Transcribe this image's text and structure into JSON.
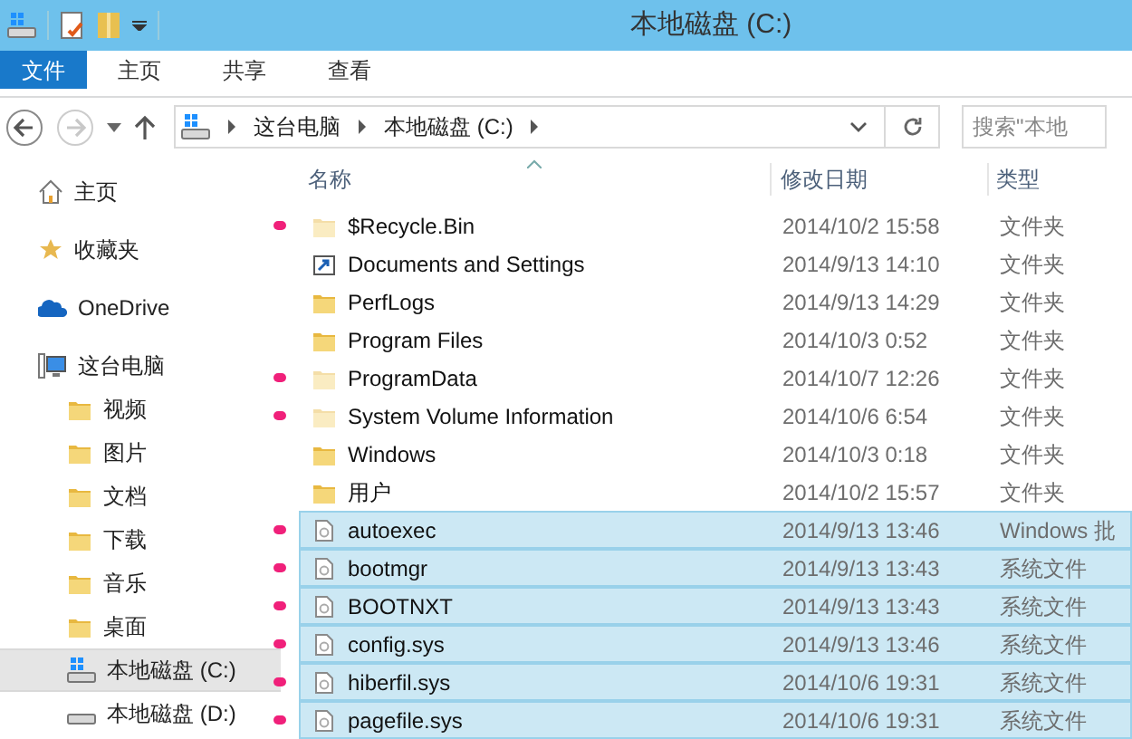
{
  "window": {
    "title": "本地磁盘 (C:)"
  },
  "ribbon_tabs": [
    {
      "label": "文件",
      "selected": true
    },
    {
      "label": "主页",
      "selected": false
    },
    {
      "label": "共享",
      "selected": false
    },
    {
      "label": "查看",
      "selected": false
    }
  ],
  "address": {
    "crumbs": [
      "这台电脑",
      "本地磁盘 (C:)"
    ]
  },
  "search": {
    "placeholder": "搜索\"本地"
  },
  "sidebar": {
    "items": [
      {
        "label": "主页",
        "kind": "home",
        "selected": false
      },
      {
        "label": "收藏夹",
        "kind": "star",
        "selected": false
      },
      {
        "label": "OneDrive",
        "kind": "cloud",
        "selected": false
      },
      {
        "label": "这台电脑",
        "kind": "computer",
        "selected": false,
        "children": [
          {
            "label": "视频",
            "kind": "folder",
            "selected": false
          },
          {
            "label": "图片",
            "kind": "folder",
            "selected": false
          },
          {
            "label": "文档",
            "kind": "folder",
            "selected": false
          },
          {
            "label": "下载",
            "kind": "folder",
            "selected": false
          },
          {
            "label": "音乐",
            "kind": "folder",
            "selected": false
          },
          {
            "label": "桌面",
            "kind": "folder",
            "selected": false
          },
          {
            "label": "本地磁盘 (C:)",
            "kind": "system-drive",
            "selected": true
          },
          {
            "label": "本地磁盘 (D:)",
            "kind": "drive",
            "selected": false
          }
        ]
      }
    ]
  },
  "table": {
    "columns": [
      "名称",
      "修改日期",
      "类型"
    ],
    "rows": [
      {
        "name": "$Recycle.Bin",
        "date": "2014/10/2 15:58",
        "type": "文件夹",
        "kind": "hidden-folder",
        "selected": false,
        "marked": true
      },
      {
        "name": "Documents and Settings",
        "date": "2014/9/13 14:10",
        "type": "文件夹",
        "kind": "shortcut",
        "selected": false,
        "marked": false
      },
      {
        "name": "PerfLogs",
        "date": "2014/9/13 14:29",
        "type": "文件夹",
        "kind": "folder",
        "selected": false,
        "marked": false
      },
      {
        "name": "Program Files",
        "date": "2014/10/3 0:52",
        "type": "文件夹",
        "kind": "folder",
        "selected": false,
        "marked": false
      },
      {
        "name": "ProgramData",
        "date": "2014/10/7 12:26",
        "type": "文件夹",
        "kind": "hidden-folder",
        "selected": false,
        "marked": true
      },
      {
        "name": "System Volume Information",
        "date": "2014/10/6 6:54",
        "type": "文件夹",
        "kind": "hidden-folder",
        "selected": false,
        "marked": true
      },
      {
        "name": "Windows",
        "date": "2014/10/3 0:18",
        "type": "文件夹",
        "kind": "folder",
        "selected": false,
        "marked": false
      },
      {
        "name": "用户",
        "date": "2014/10/2 15:57",
        "type": "文件夹",
        "kind": "folder",
        "selected": false,
        "marked": false
      },
      {
        "name": "autoexec",
        "date": "2014/9/13 13:46",
        "type": "Windows 批",
        "kind": "file",
        "selected": true,
        "marked": true
      },
      {
        "name": "bootmgr",
        "date": "2014/9/13 13:43",
        "type": "系统文件",
        "kind": "file",
        "selected": true,
        "marked": true
      },
      {
        "name": "BOOTNXT",
        "date": "2014/9/13 13:43",
        "type": "系统文件",
        "kind": "file",
        "selected": true,
        "marked": true
      },
      {
        "name": "config.sys",
        "date": "2014/9/13 13:46",
        "type": "系统文件",
        "kind": "file",
        "selected": true,
        "marked": true
      },
      {
        "name": "hiberfil.sys",
        "date": "2014/10/6 19:31",
        "type": "系统文件",
        "kind": "file",
        "selected": true,
        "marked": true
      },
      {
        "name": "pagefile.sys",
        "date": "2014/10/6 19:31",
        "type": "系统文件",
        "kind": "file",
        "selected": true,
        "marked": true
      }
    ]
  }
}
